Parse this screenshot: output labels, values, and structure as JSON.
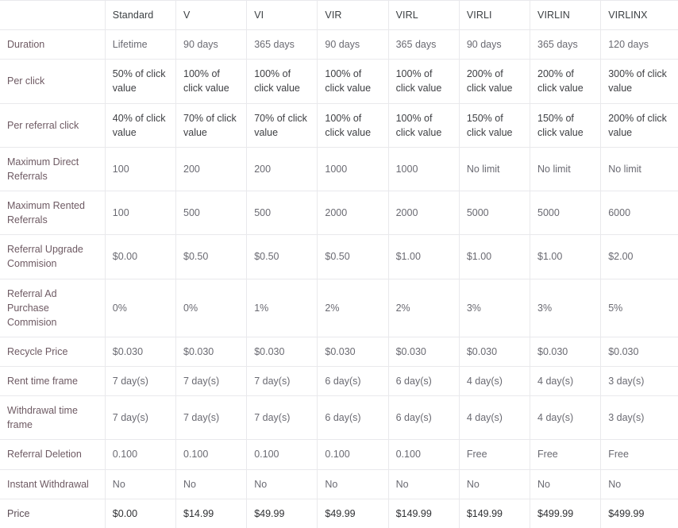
{
  "table": {
    "corner_label": "",
    "columns": [
      "Standard",
      "V",
      "VI",
      "VIR",
      "VIRL",
      "VIRLI",
      "VIRLIN",
      "VIRLINX"
    ],
    "rows": [
      {
        "label": "Duration",
        "emphasis": false,
        "values": [
          "Lifetime",
          "90 days",
          "365 days",
          "90 days",
          "365 days",
          "90 days",
          "365 days",
          "120 days"
        ]
      },
      {
        "label": "Per click",
        "emphasis": true,
        "values": [
          "50% of click value",
          "100% of click value",
          "100% of click value",
          "100% of click value",
          "100% of click value",
          "200% of click value",
          "200% of click value",
          "300% of click value"
        ]
      },
      {
        "label": "Per referral click",
        "emphasis": true,
        "values": [
          "40% of click value",
          "70% of click value",
          "70% of click value",
          "100% of click value",
          "100% of click value",
          "150% of click value",
          "150% of click value",
          "200% of click value"
        ]
      },
      {
        "label": "Maximum Direct Referrals",
        "emphasis": false,
        "values": [
          "100",
          "200",
          "200",
          "1000",
          "1000",
          "No limit",
          "No limit",
          "No limit"
        ]
      },
      {
        "label": "Maximum Rented Referrals",
        "emphasis": false,
        "values": [
          "100",
          "500",
          "500",
          "2000",
          "2000",
          "5000",
          "5000",
          "6000"
        ]
      },
      {
        "label": "Referral Upgrade Commision",
        "emphasis": false,
        "values": [
          "$0.00",
          "$0.50",
          "$0.50",
          "$0.50",
          "$1.00",
          "$1.00",
          "$1.00",
          "$2.00"
        ]
      },
      {
        "label": "Referral Ad Purchase Commision",
        "emphasis": false,
        "values": [
          "0%",
          "0%",
          "1%",
          "2%",
          "2%",
          "3%",
          "3%",
          "5%"
        ]
      },
      {
        "label": "Recycle Price",
        "emphasis": false,
        "values": [
          "$0.030",
          "$0.030",
          "$0.030",
          "$0.030",
          "$0.030",
          "$0.030",
          "$0.030",
          "$0.030"
        ]
      },
      {
        "label": "Rent time frame",
        "emphasis": false,
        "values": [
          "7 day(s)",
          "7 day(s)",
          "7 day(s)",
          "6 day(s)",
          "6 day(s)",
          "4 day(s)",
          "4 day(s)",
          "3 day(s)"
        ]
      },
      {
        "label": "Withdrawal time frame",
        "emphasis": false,
        "values": [
          "7 day(s)",
          "7 day(s)",
          "7 day(s)",
          "6 day(s)",
          "6 day(s)",
          "4 day(s)",
          "4 day(s)",
          "3 day(s)"
        ]
      },
      {
        "label": "Referral Deletion",
        "emphasis": false,
        "values": [
          "0.100",
          "0.100",
          "0.100",
          "0.100",
          "0.100",
          "Free",
          "Free",
          "Free"
        ]
      },
      {
        "label": "Instant Withdrawal",
        "emphasis": false,
        "values": [
          "No",
          "No",
          "No",
          "No",
          "No",
          "No",
          "No",
          "No"
        ]
      },
      {
        "label": "Price",
        "emphasis": false,
        "price_row": true,
        "values": [
          "$0.00",
          "$14.99",
          "$49.99",
          "$49.99",
          "$149.99",
          "$149.99",
          "$499.99",
          "$499.99"
        ]
      }
    ]
  },
  "colors": {
    "border": "#e9e9ec",
    "label_text": "#6e5a63",
    "value_text": "#6a6a72",
    "header_text": "#3c4043",
    "emphasis_text": "#3f4044",
    "background": "#ffffff"
  }
}
